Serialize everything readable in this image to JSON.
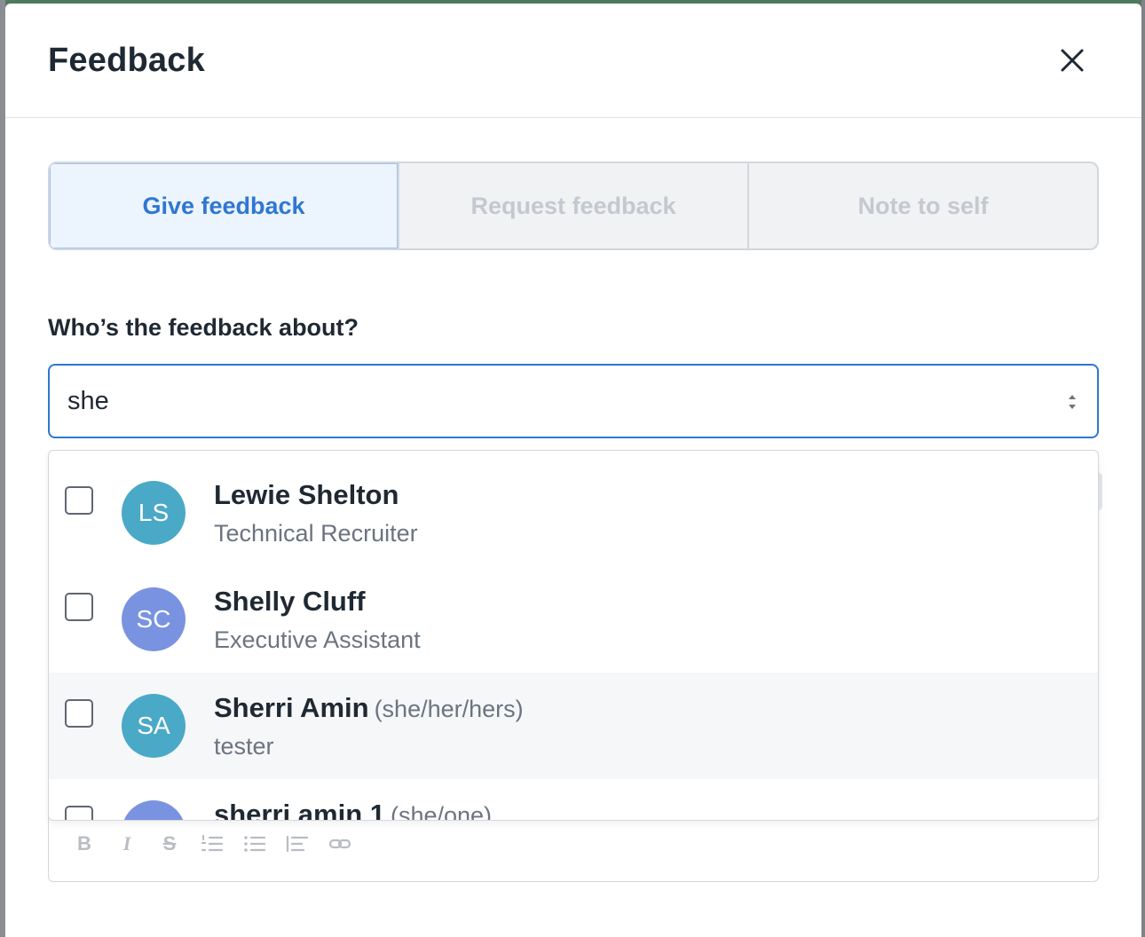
{
  "modal": {
    "title": "Feedback"
  },
  "tabs": [
    {
      "label": "Give feedback",
      "active": true
    },
    {
      "label": "Request feedback",
      "active": false
    },
    {
      "label": "Note to self",
      "active": false
    }
  ],
  "recipient": {
    "label": "Who’s the feedback about?",
    "search_value": "she"
  },
  "options": [
    {
      "initials": "LS",
      "name": "Lewie Shelton",
      "pronouns": "",
      "title": "Technical Recruiter",
      "avatar_color": "#4aa9c6"
    },
    {
      "initials": "SC",
      "name": "Shelly Cluff",
      "pronouns": "",
      "title": "Executive Assistant",
      "avatar_color": "#7a93e0"
    },
    {
      "initials": "SA",
      "name": "Sherri Amin",
      "pronouns": "(she/her/hers)",
      "title": "tester",
      "avatar_color": "#4aa9c6"
    },
    {
      "initials": "",
      "name": "sherri amin 1",
      "pronouns": "(she/one)",
      "title": "",
      "avatar_color": "#7a93e0"
    }
  ],
  "editor_toolbar": {
    "icons": [
      "bold-icon",
      "italic-icon",
      "strikethrough-icon",
      "ordered-list-icon",
      "bullet-list-icon",
      "indent-icon",
      "link-icon"
    ]
  },
  "colors": {
    "accent": "#2f77d1",
    "active_tab_bg": "#ecf4fe"
  }
}
